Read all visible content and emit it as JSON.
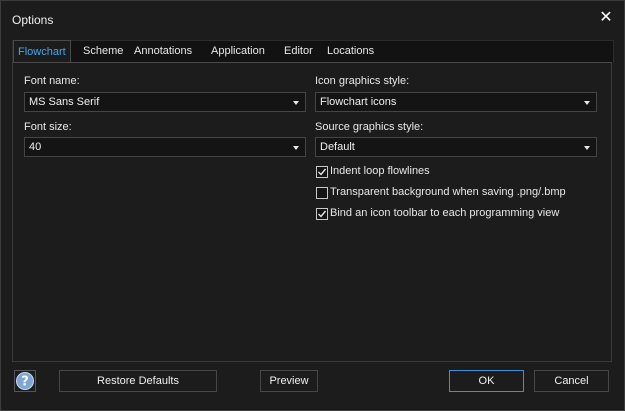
{
  "window": {
    "title": "Options",
    "close_icon": "close-icon"
  },
  "tabs": [
    "Flowchart",
    "Scheme",
    "Annotations",
    "Application",
    "Editor",
    "Locations"
  ],
  "active_tab": "Flowchart",
  "left": {
    "font_name_label": "Font name:",
    "font_name_value": "MS Sans Serif",
    "font_size_label": "Font size:",
    "font_size_value": "40"
  },
  "right": {
    "icon_style_label": "Icon graphics style:",
    "icon_style_value": "Flowchart icons",
    "source_style_label": "Source graphics style:",
    "source_style_value": "Default",
    "checkboxes": [
      {
        "label": "Indent loop flowlines",
        "checked": true
      },
      {
        "label": "Transparent background when saving .png/.bmp",
        "checked": false
      },
      {
        "label": "Bind an icon toolbar to each programming view",
        "checked": true
      }
    ]
  },
  "footer": {
    "help_icon": "help-icon",
    "restore_label": "Restore Defaults",
    "preview_label": "Preview",
    "ok_label": "OK",
    "cancel_label": "Cancel"
  },
  "colors": {
    "background": "#1c1c1c",
    "accent": "#3ea8f0",
    "help_icon": "#7aa6d8"
  }
}
